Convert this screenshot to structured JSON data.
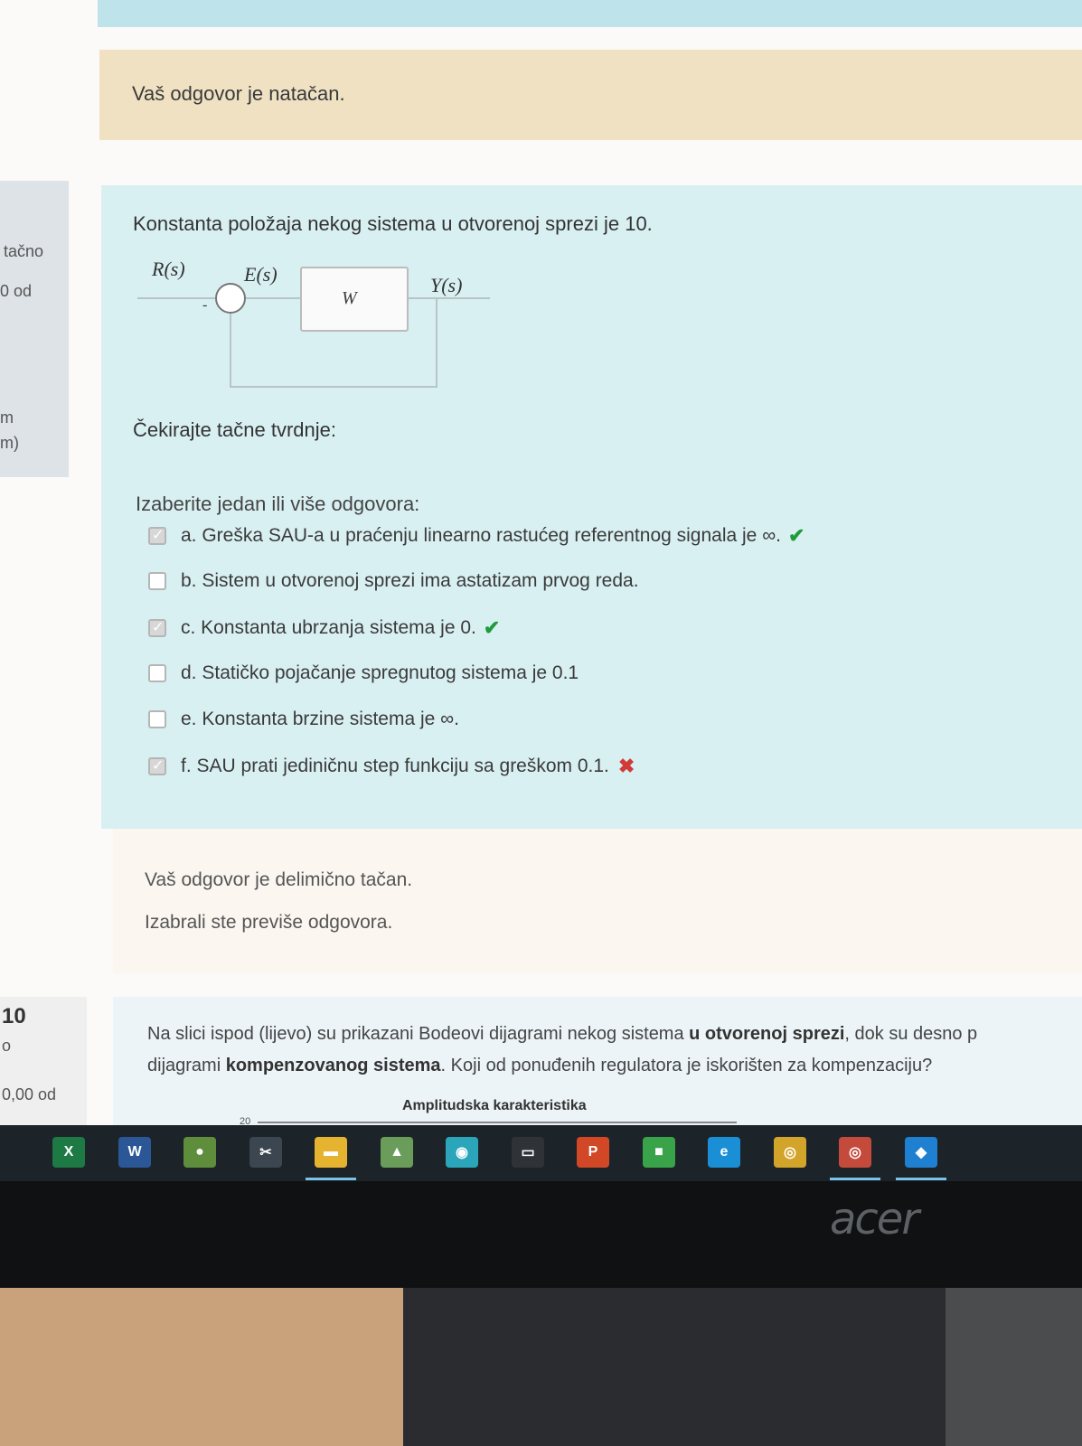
{
  "feedback_top": {
    "message": "Vaš odgovor je natačan."
  },
  "sidebar1": {
    "status": "tačno",
    "points": "0 od",
    "line3": "m",
    "line4": "m)"
  },
  "question": {
    "text": "Konstanta položaja nekog sistema u otvorenoj sprezi je 10.",
    "diagram": {
      "r": "R(s)",
      "e": "E(s)",
      "w": "W",
      "y": "Y(s)",
      "minus": "-"
    },
    "instruction": "Čekirajte tačne tvrdnje:",
    "prompt": "Izaberite jedan ili više odgovora:",
    "options": [
      {
        "label": "a. Greška SAU-a u praćenju linearno rastućeg referentnog signala je ∞.",
        "checked": true,
        "result": "correct"
      },
      {
        "label": "b. Sistem u otvorenoj sprezi ima astatizam prvog reda.",
        "checked": false,
        "result": ""
      },
      {
        "label": "c. Konstanta ubrzanja sistema je 0.",
        "checked": true,
        "result": "correct"
      },
      {
        "label": "d. Statičko pojačanje spregnutog sistema je 0.1",
        "checked": false,
        "result": ""
      },
      {
        "label": "e. Konstanta brzine sistema je ∞.",
        "checked": false,
        "result": ""
      },
      {
        "label": "f. SAU prati jediničnu step funkciju sa greškom 0.1.",
        "checked": true,
        "result": "wrong"
      }
    ]
  },
  "feedback_mid": {
    "line1": "Vaš odgovor je delimično tačan.",
    "line2": "Izabrali ste previše odgovora."
  },
  "sidebar2": {
    "number": "10",
    "line2": "o",
    "points": "0,00 od"
  },
  "question2": {
    "p1": "Na slici ispod (lijevo) su prikazani Bodeovi dijagrami nekog sistema ",
    "b1": "u otvorenoj sprezi",
    "p2": ", dok su desno p",
    "p3": "dijagrami ",
    "b2": "kompenzovanog sistema",
    "p4": ". Koji od ponuđenih regulatora je iskorišten za kompenzaciju?",
    "chart_title": "Amplitudska karakteristika",
    "chart_tick": "20"
  },
  "taskbar": {
    "icons": [
      {
        "name": "excel-icon",
        "glyph": "X",
        "color": "#1d7a45"
      },
      {
        "name": "word-icon",
        "glyph": "W",
        "color": "#2b5797"
      },
      {
        "name": "teams-icon",
        "glyph": "●",
        "color": "#5e8d3b"
      },
      {
        "name": "snipping-icon",
        "glyph": "✂",
        "color": "#3b4650"
      },
      {
        "name": "file-explorer-icon",
        "glyph": "▬",
        "color": "#e5b32f"
      },
      {
        "name": "matlab-icon",
        "glyph": "▲",
        "color": "#6a9c5a"
      },
      {
        "name": "app-icon",
        "glyph": "◉",
        "color": "#2aa5b9"
      },
      {
        "name": "terminal-icon",
        "glyph": "▭",
        "color": "#2f3338"
      },
      {
        "name": "powerpoint-icon",
        "glyph": "P",
        "color": "#d24726"
      },
      {
        "name": "store-icon",
        "glyph": "■",
        "color": "#39a34a"
      },
      {
        "name": "edge-icon",
        "glyph": "e",
        "color": "#1a8fd6"
      },
      {
        "name": "chrome-icon",
        "glyph": "◎",
        "color": "#d3a42a"
      },
      {
        "name": "chrome-alt-icon",
        "glyph": "◎",
        "color": "#c44a3c"
      },
      {
        "name": "photos-icon",
        "glyph": "◆",
        "color": "#1f7fd0"
      }
    ]
  },
  "monitor": {
    "brand": "acer"
  }
}
